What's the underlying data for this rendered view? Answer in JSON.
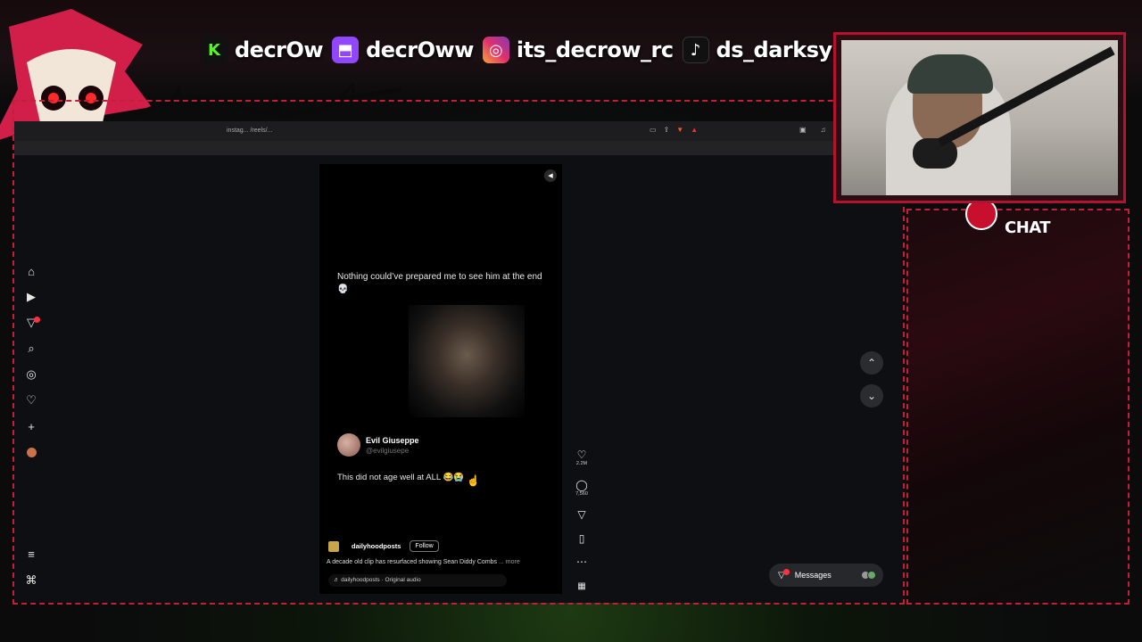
{
  "socials": [
    {
      "platform": "kick",
      "icon": "kick-icon",
      "glyph": "K",
      "color": "#53fc18",
      "name": "decrOw"
    },
    {
      "platform": "twitch",
      "icon": "twitch-icon",
      "glyph": "⬒",
      "color": "#9146ff",
      "name": "decrOww"
    },
    {
      "platform": "instagram",
      "icon": "instagram-icon",
      "glyph": "◎",
      "color": "#e1306c",
      "name": "its_decrow_rc"
    },
    {
      "platform": "tiktok",
      "icon": "tiktok-icon",
      "glyph": "♪",
      "color": "#111111",
      "name": "ds_darksync"
    }
  ],
  "chat": {
    "label": "CHAT"
  },
  "browser": {
    "url": "instag... /reels/...",
    "right_icons": [
      "▣",
      "♫"
    ]
  },
  "reel": {
    "caption": "Nothing could’ve prepared me to see him at the end 💀",
    "tweet": {
      "name": "Evil Giuseppe",
      "handle": "@evilgiusepe",
      "text": "This did not age well at ALL 😂😭"
    },
    "author": "dailyhoodposts",
    "follow_label": "Follow",
    "description": "A decade old clip has resurfaced showing Sean Diddy Combs",
    "more_label": "... more",
    "audio": "♬ dailyhoodposts · Original audio"
  },
  "actions": {
    "likes": "2.2M",
    "comments": "7,560"
  },
  "messages": {
    "label": "Messages",
    "badge": "1"
  },
  "colors": {
    "frame": "#c51d3a",
    "accent": "#ff3040"
  }
}
